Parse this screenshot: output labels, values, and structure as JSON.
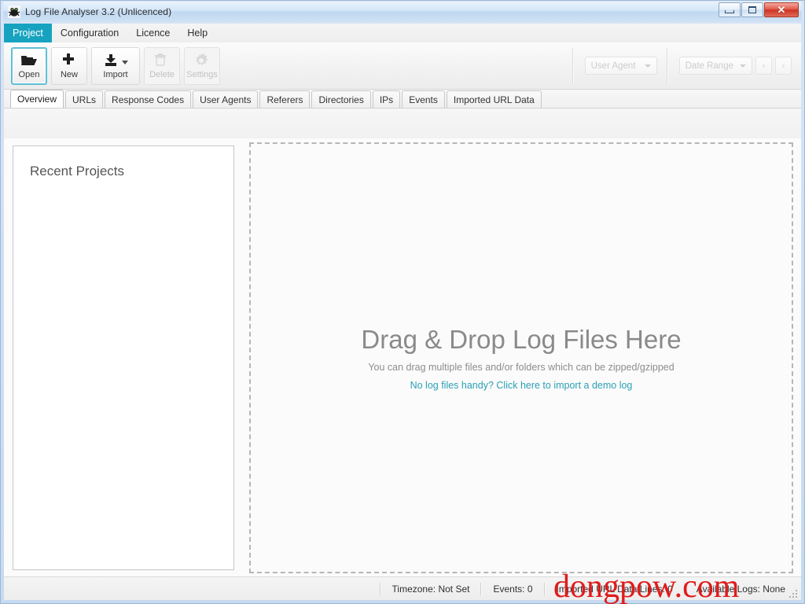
{
  "window": {
    "title": "Log File Analyser 3.2 (Unlicenced)",
    "app_icon": "frog-logo-icon",
    "minimize_label": "",
    "maximize_label": "",
    "close_label": "✕",
    "accent_color": "#17a3c0",
    "link_color": "#2b9fb5",
    "title_bar_color": "#cfe1f4",
    "close_button_color": "#cd3522"
  },
  "menubar": {
    "items": [
      {
        "label": "Project",
        "active": true
      },
      {
        "label": "Configuration",
        "active": false
      },
      {
        "label": "Licence",
        "active": false
      },
      {
        "label": "Help",
        "active": false
      }
    ]
  },
  "toolbar": {
    "buttons": [
      {
        "label": "Open",
        "icon": "folder-open-icon",
        "disabled": false,
        "focused": true
      },
      {
        "label": "New",
        "icon": "plus-icon",
        "disabled": false,
        "focused": false
      },
      {
        "label": "Import",
        "icon": "import-download-icon",
        "disabled": false,
        "focused": false,
        "has_dropdown": true
      },
      {
        "label": "Delete",
        "icon": "trash-icon",
        "disabled": true,
        "focused": false
      },
      {
        "label": "Settings",
        "icon": "gear-icon",
        "disabled": true,
        "focused": false
      }
    ],
    "filters": [
      {
        "label": "User Agent",
        "icon": "chevron-down-icon",
        "disabled": true
      },
      {
        "label": "Date Range",
        "icon": "chevron-down-icon",
        "disabled": true
      }
    ],
    "nav": [
      {
        "label": "‹",
        "icon": "chevron-left-icon",
        "disabled": true
      },
      {
        "label": "›",
        "icon": "chevron-right-icon",
        "disabled": true
      }
    ]
  },
  "tabs": [
    {
      "label": "Overview",
      "active": true
    },
    {
      "label": "URLs",
      "active": false
    },
    {
      "label": "Response Codes",
      "active": false
    },
    {
      "label": "User Agents",
      "active": false
    },
    {
      "label": "Referers",
      "active": false
    },
    {
      "label": "Directories",
      "active": false
    },
    {
      "label": "IPs",
      "active": false
    },
    {
      "label": "Events",
      "active": false
    },
    {
      "label": "Imported URL Data",
      "active": false
    }
  ],
  "main": {
    "recent_projects": {
      "title": "Recent Projects",
      "items": []
    },
    "dropzone": {
      "title": "Drag & Drop Log Files Here",
      "subtitle": "You can drag multiple files and/or folders which can be zipped/gzipped",
      "link": "No log files handy? Click here to import a demo log"
    }
  },
  "statusbar": {
    "items": [
      {
        "label": "Timezone: Not Set"
      },
      {
        "label": "Events: 0"
      },
      {
        "label": "Imported URL Data Lines: 0"
      },
      {
        "label": "Available Logs: None"
      }
    ]
  },
  "watermark": {
    "text": "dongpow.com",
    "color": "#e01b1b"
  }
}
